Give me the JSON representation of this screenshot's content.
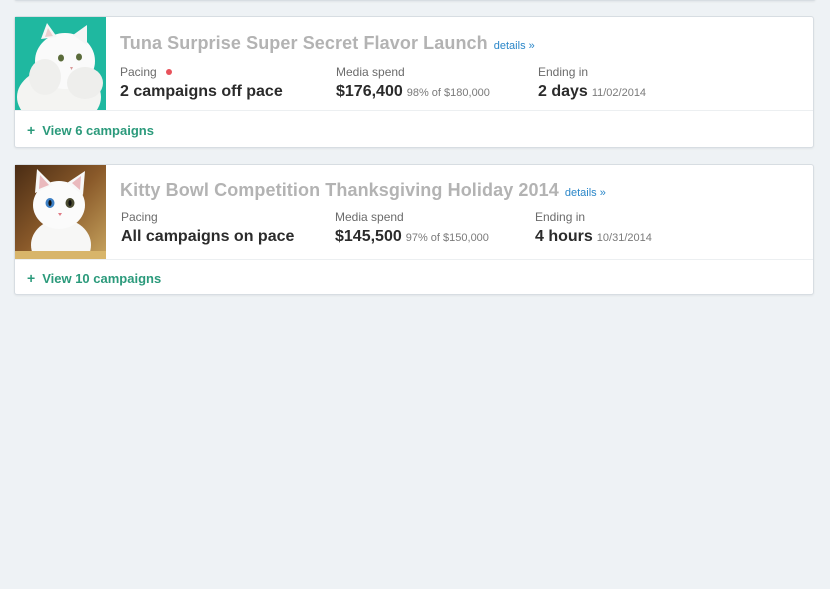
{
  "colors": {
    "background": "#eef2f5",
    "title": "#b3b3b3",
    "link": "#2a86c8",
    "view_link": "#2b9a7b",
    "off_pace_dot": "#e8525b"
  },
  "campaigns": [
    {
      "title": "Tuna Surprise Super Secret Flavor Launch",
      "details_label": "details »",
      "thumbnail_icon": "white-persian-cat-on-teal",
      "pacing_label": "Pacing",
      "pacing_indicator": "off-pace-dot",
      "pacing_value": "2 campaigns off pace",
      "spend_label": "Media spend",
      "spend_value": "$176,400",
      "spend_detail": "98% of $180,000",
      "ending_label": "Ending in",
      "ending_value": "2 days",
      "ending_date": "11/02/2014",
      "view_label": "View 6 campaigns",
      "view_icon": "plus-icon"
    },
    {
      "title": "Kitty Bowl Competition Thanksgiving Holiday 2014",
      "details_label": "details »",
      "thumbnail_icon": "white-kitten-photo",
      "pacing_label": "Pacing",
      "pacing_value": "All campaigns on pace",
      "spend_label": "Media spend",
      "spend_value": "$145,500",
      "spend_detail": "97% of $150,000",
      "ending_label": "Ending in",
      "ending_value": "4 hours",
      "ending_date": "10/31/2014",
      "view_label": "View 10 campaigns",
      "view_icon": "plus-icon"
    }
  ]
}
